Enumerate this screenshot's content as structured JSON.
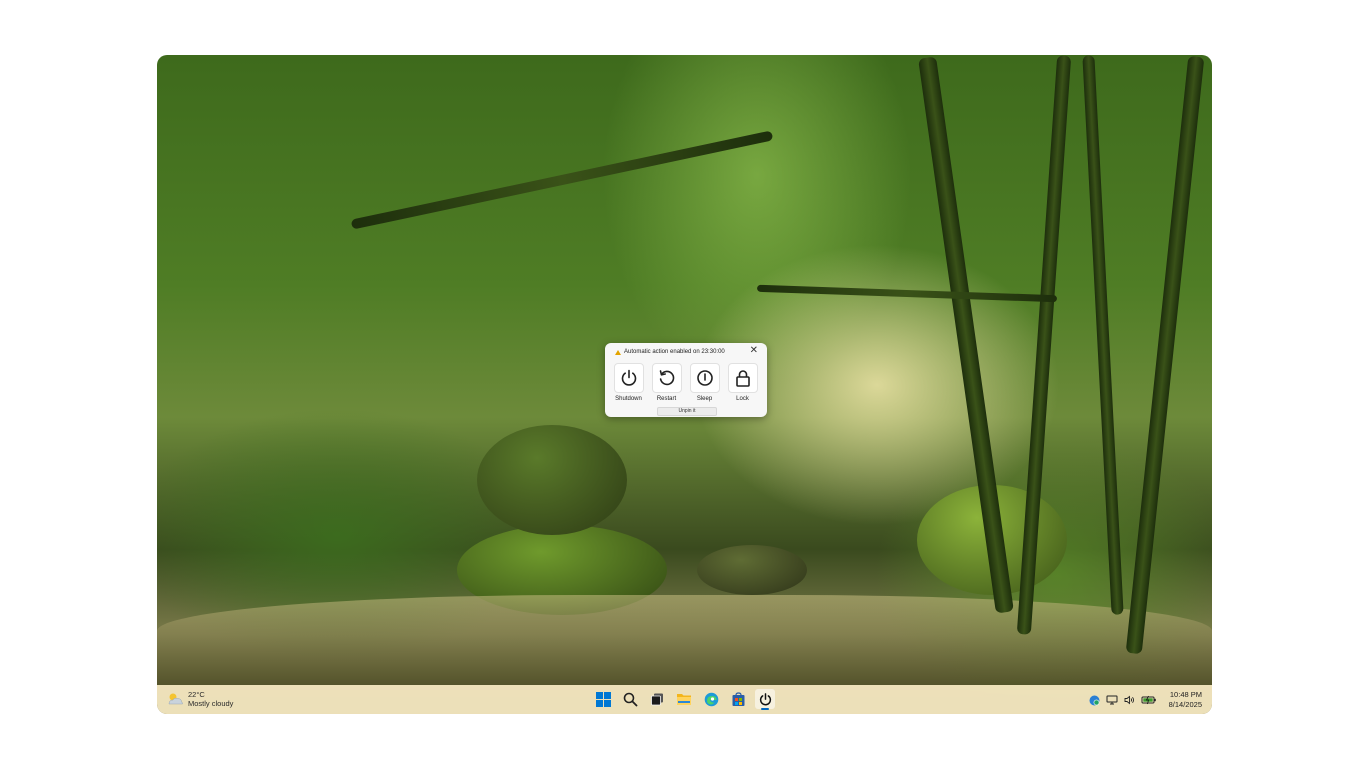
{
  "popup": {
    "message": "Automatic action enabled on 23:30:00",
    "close_glyph": "✕",
    "actions": [
      {
        "label": "Shutdown",
        "icon": "power-icon"
      },
      {
        "label": "Restart",
        "icon": "restart-icon"
      },
      {
        "label": "Sleep",
        "icon": "sleep-icon"
      },
      {
        "label": "Lock",
        "icon": "lock-icon"
      }
    ],
    "unpin_label": "Unpin it"
  },
  "taskbar": {
    "weather": {
      "temp": "22°C",
      "condition": "Mostly cloudy",
      "icon": "partly-cloudy-icon"
    },
    "apps": [
      "windows-start-icon",
      "search-icon",
      "task-view-icon",
      "file-explorer-icon",
      "edge-browser-icon",
      "store-icon",
      "power-app-icon"
    ],
    "active_app": "power-app-icon",
    "tray": [
      "defender-icon",
      "network-icon",
      "volume-icon",
      "battery-icon"
    ],
    "clock": {
      "time": "10:48 PM",
      "date": "8/14/2025"
    }
  },
  "colors": {
    "accent": "#0067c0",
    "warning": "#e3a400",
    "taskbar": "#f8ecc4"
  }
}
